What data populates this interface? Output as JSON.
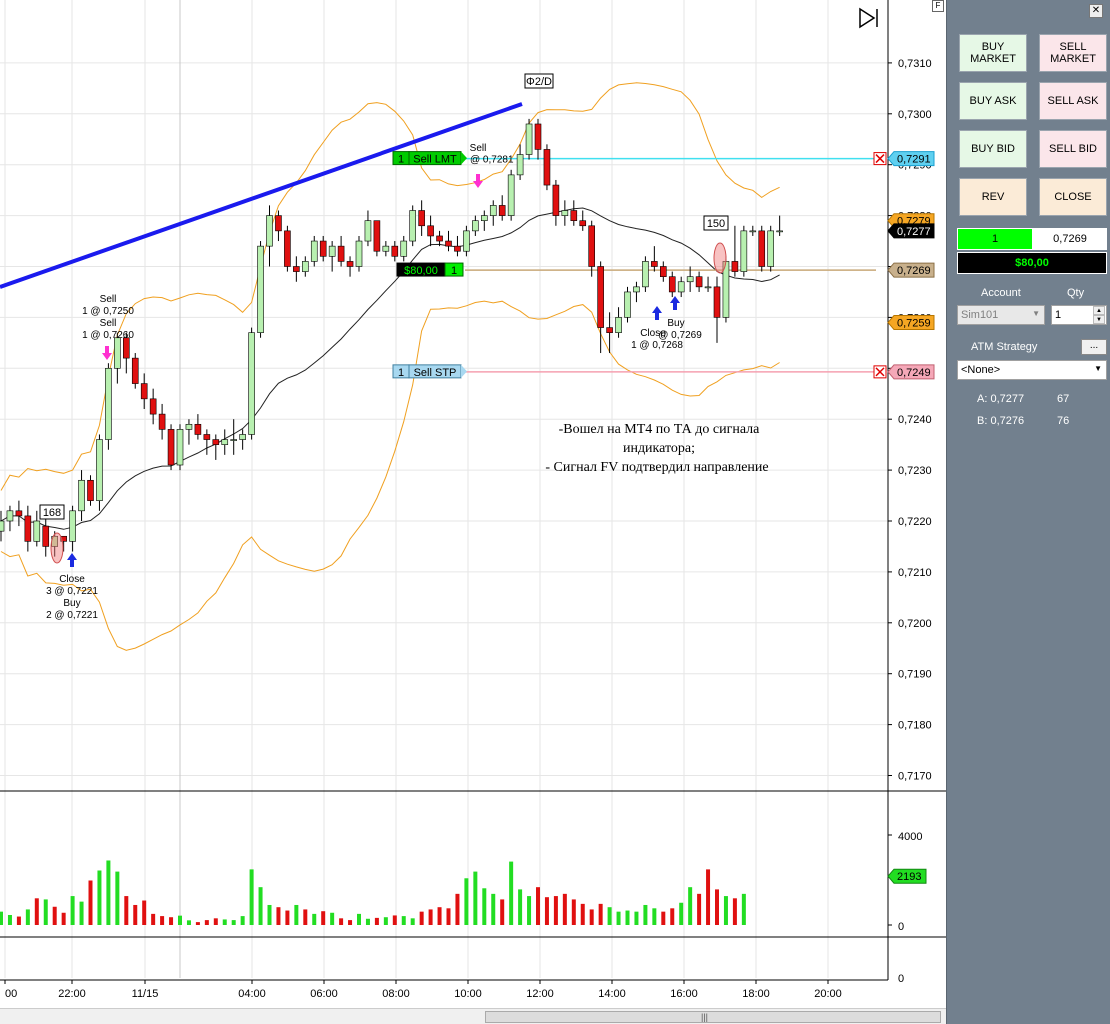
{
  "window": {
    "corner_label": "F",
    "playback_icon": "play-to-end-icon"
  },
  "price_axis": {
    "ticks": [
      "0,7310",
      "0,7300",
      "0,7290",
      "0,7280",
      "0,7270",
      "0,7260",
      "0,7250",
      "0,7240",
      "0,7230",
      "0,7220",
      "0,7210",
      "0,7200",
      "0,7190",
      "0,7180",
      "0,7170"
    ],
    "flags": [
      {
        "text": "0,7291",
        "bg": "#5fd0f0",
        "border": "#1aa0d0"
      },
      {
        "text": "0,7279",
        "bg": "#f5a623",
        "border": "#b87700"
      },
      {
        "text": "0,7277",
        "bg": "#000000",
        "border": "#000000"
      },
      {
        "text": "0,7269",
        "bg": "#c8b08c",
        "border": "#8b6f45"
      },
      {
        "text": "0,7259",
        "bg": "#f5a623",
        "border": "#b87700"
      },
      {
        "text": "0,7249",
        "bg": "#f5a8b8",
        "border": "#c06070"
      }
    ]
  },
  "volume_axis": {
    "ticks": [
      "4000",
      "2000",
      "0",
      "0"
    ],
    "current": "2193"
  },
  "time_axis": {
    "ticks": [
      "00",
      "22:00",
      "11/15",
      "04:00",
      "06:00",
      "08:00",
      "10:00",
      "12:00",
      "14:00",
      "16:00",
      "18:00",
      "20:00"
    ]
  },
  "orders": {
    "sell_lmt": {
      "qty": "1",
      "label": "Sell LMT",
      "price_label": "@ 0,7281"
    },
    "position": {
      "pnl": "$80,00",
      "qty": "1"
    },
    "sell_stp": {
      "qty": "1",
      "label": "Sell STP"
    }
  },
  "annotations": {
    "phi_label": "Φ2/D",
    "box_168": "168",
    "box_150": "150",
    "sell1": "Sell",
    "sell1_qty": "1 @ 0,7250",
    "sell2": "Sell",
    "sell2_qty": "1 @ 0,7260",
    "close1": "Close",
    "close1_qty": "3 @ 0,7221",
    "buy1": "Buy",
    "buy1_qty": "2 @ 0,7221",
    "sell3": "Sell",
    "buy2": "Buy",
    "close2": "Close",
    "buy2_qty": "@ 0,7269",
    "close2_qty": "1 @ 0,7268",
    "note_line1": "-Вошел на МТ4 по ТА до сигнала",
    "note_line2": "индикатора;",
    "note_line3": "- Сигнал FV подтвердил направление"
  },
  "chart_data": {
    "type": "candlestick",
    "title": "",
    "y_range": [
      0.7164,
      0.7322
    ],
    "time_ticks": [
      "00",
      "22:00",
      "11/15",
      "04:00",
      "06:00",
      "08:00",
      "10:00",
      "12:00",
      "14:00",
      "16:00",
      "18:00",
      "20:00"
    ],
    "candles": [
      {
        "o": 0.7218,
        "h": 0.7222,
        "l": 0.7216,
        "c": 0.722
      },
      {
        "o": 0.722,
        "h": 0.7223,
        "l": 0.7218,
        "c": 0.7222
      },
      {
        "o": 0.7222,
        "h": 0.7224,
        "l": 0.7219,
        "c": 0.7221
      },
      {
        "o": 0.7221,
        "h": 0.7223,
        "l": 0.7214,
        "c": 0.7216
      },
      {
        "o": 0.7216,
        "h": 0.7222,
        "l": 0.7215,
        "c": 0.722
      },
      {
        "o": 0.7219,
        "h": 0.7221,
        "l": 0.7213,
        "c": 0.7215
      },
      {
        "o": 0.7215,
        "h": 0.7218,
        "l": 0.7213,
        "c": 0.7217
      },
      {
        "o": 0.7217,
        "h": 0.7216,
        "l": 0.7214,
        "c": 0.7216
      },
      {
        "o": 0.7216,
        "h": 0.7223,
        "l": 0.7214,
        "c": 0.7222
      },
      {
        "o": 0.7222,
        "h": 0.723,
        "l": 0.722,
        "c": 0.7228
      },
      {
        "o": 0.7228,
        "h": 0.7229,
        "l": 0.7223,
        "c": 0.7224
      },
      {
        "o": 0.7224,
        "h": 0.7237,
        "l": 0.7222,
        "c": 0.7236
      },
      {
        "o": 0.7236,
        "h": 0.7251,
        "l": 0.7234,
        "c": 0.725
      },
      {
        "o": 0.725,
        "h": 0.7257,
        "l": 0.7247,
        "c": 0.7256
      },
      {
        "o": 0.7256,
        "h": 0.7257,
        "l": 0.7249,
        "c": 0.7252
      },
      {
        "o": 0.7252,
        "h": 0.7253,
        "l": 0.7246,
        "c": 0.7247
      },
      {
        "o": 0.7247,
        "h": 0.7249,
        "l": 0.7242,
        "c": 0.7244
      },
      {
        "o": 0.7244,
        "h": 0.7246,
        "l": 0.7239,
        "c": 0.7241
      },
      {
        "o": 0.7241,
        "h": 0.7243,
        "l": 0.7236,
        "c": 0.7238
      },
      {
        "o": 0.7238,
        "h": 0.7239,
        "l": 0.723,
        "c": 0.7231
      },
      {
        "o": 0.7231,
        "h": 0.7239,
        "l": 0.723,
        "c": 0.7238
      },
      {
        "o": 0.7238,
        "h": 0.724,
        "l": 0.7235,
        "c": 0.7239
      },
      {
        "o": 0.7239,
        "h": 0.7241,
        "l": 0.7236,
        "c": 0.7237
      },
      {
        "o": 0.7237,
        "h": 0.7238,
        "l": 0.7233,
        "c": 0.7236
      },
      {
        "o": 0.7236,
        "h": 0.7237,
        "l": 0.7232,
        "c": 0.7235
      },
      {
        "o": 0.7235,
        "h": 0.7238,
        "l": 0.7233,
        "c": 0.7236
      },
      {
        "o": 0.7236,
        "h": 0.724,
        "l": 0.7233,
        "c": 0.7236
      },
      {
        "o": 0.7236,
        "h": 0.7238,
        "l": 0.7234,
        "c": 0.7237
      },
      {
        "o": 0.7237,
        "h": 0.7258,
        "l": 0.7236,
        "c": 0.7257
      },
      {
        "o": 0.7257,
        "h": 0.7275,
        "l": 0.7256,
        "c": 0.7274
      },
      {
        "o": 0.7274,
        "h": 0.7282,
        "l": 0.727,
        "c": 0.728
      },
      {
        "o": 0.728,
        "h": 0.7281,
        "l": 0.7275,
        "c": 0.7277
      },
      {
        "o": 0.7277,
        "h": 0.7278,
        "l": 0.7269,
        "c": 0.727
      },
      {
        "o": 0.727,
        "h": 0.7272,
        "l": 0.7267,
        "c": 0.7269
      },
      {
        "o": 0.7269,
        "h": 0.7272,
        "l": 0.7268,
        "c": 0.7271
      },
      {
        "o": 0.7271,
        "h": 0.7276,
        "l": 0.727,
        "c": 0.7275
      },
      {
        "o": 0.7275,
        "h": 0.7276,
        "l": 0.7271,
        "c": 0.7272
      },
      {
        "o": 0.7272,
        "h": 0.7275,
        "l": 0.7269,
        "c": 0.7274
      },
      {
        "o": 0.7274,
        "h": 0.7276,
        "l": 0.727,
        "c": 0.7271
      },
      {
        "o": 0.7271,
        "h": 0.7272,
        "l": 0.7268,
        "c": 0.727
      },
      {
        "o": 0.727,
        "h": 0.7276,
        "l": 0.7269,
        "c": 0.7275
      },
      {
        "o": 0.7275,
        "h": 0.7281,
        "l": 0.7274,
        "c": 0.7279
      },
      {
        "o": 0.7279,
        "h": 0.7279,
        "l": 0.7272,
        "c": 0.7273
      },
      {
        "o": 0.7273,
        "h": 0.7275,
        "l": 0.7272,
        "c": 0.7274
      },
      {
        "o": 0.7274,
        "h": 0.7275,
        "l": 0.7271,
        "c": 0.7272
      },
      {
        "o": 0.7272,
        "h": 0.7276,
        "l": 0.7271,
        "c": 0.7275
      },
      {
        "o": 0.7275,
        "h": 0.7282,
        "l": 0.7274,
        "c": 0.7281
      },
      {
        "o": 0.7281,
        "h": 0.7283,
        "l": 0.7276,
        "c": 0.7278
      },
      {
        "o": 0.7278,
        "h": 0.728,
        "l": 0.7274,
        "c": 0.7276
      },
      {
        "o": 0.7276,
        "h": 0.7277,
        "l": 0.7274,
        "c": 0.7275
      },
      {
        "o": 0.7275,
        "h": 0.7277,
        "l": 0.7273,
        "c": 0.7274
      },
      {
        "o": 0.7274,
        "h": 0.7276,
        "l": 0.7272,
        "c": 0.7273
      },
      {
        "o": 0.7273,
        "h": 0.7278,
        "l": 0.7272,
        "c": 0.7277
      },
      {
        "o": 0.7277,
        "h": 0.728,
        "l": 0.7276,
        "c": 0.7279
      },
      {
        "o": 0.7279,
        "h": 0.7281,
        "l": 0.7277,
        "c": 0.728
      },
      {
        "o": 0.728,
        "h": 0.7283,
        "l": 0.7278,
        "c": 0.7282
      },
      {
        "o": 0.7282,
        "h": 0.7284,
        "l": 0.7279,
        "c": 0.728
      },
      {
        "o": 0.728,
        "h": 0.7289,
        "l": 0.7279,
        "c": 0.7288
      },
      {
        "o": 0.7288,
        "h": 0.7294,
        "l": 0.7287,
        "c": 0.7292
      },
      {
        "o": 0.7292,
        "h": 0.7299,
        "l": 0.7291,
        "c": 0.7298
      },
      {
        "o": 0.7298,
        "h": 0.7299,
        "l": 0.7291,
        "c": 0.7293
      },
      {
        "o": 0.7293,
        "h": 0.7294,
        "l": 0.7285,
        "c": 0.7286
      },
      {
        "o": 0.7286,
        "h": 0.7287,
        "l": 0.7278,
        "c": 0.728
      },
      {
        "o": 0.728,
        "h": 0.7283,
        "l": 0.7278,
        "c": 0.7281
      },
      {
        "o": 0.7281,
        "h": 0.7283,
        "l": 0.7278,
        "c": 0.7279
      },
      {
        "o": 0.7279,
        "h": 0.7281,
        "l": 0.7277,
        "c": 0.7278
      },
      {
        "o": 0.7278,
        "h": 0.7279,
        "l": 0.7268,
        "c": 0.727
      },
      {
        "o": 0.727,
        "h": 0.7271,
        "l": 0.7253,
        "c": 0.7258
      },
      {
        "o": 0.7258,
        "h": 0.7261,
        "l": 0.7253,
        "c": 0.7257
      },
      {
        "o": 0.7257,
        "h": 0.7262,
        "l": 0.7256,
        "c": 0.726
      },
      {
        "o": 0.726,
        "h": 0.7266,
        "l": 0.7259,
        "c": 0.7265
      },
      {
        "o": 0.7265,
        "h": 0.7267,
        "l": 0.7263,
        "c": 0.7266
      },
      {
        "o": 0.7266,
        "h": 0.7272,
        "l": 0.7265,
        "c": 0.7271
      },
      {
        "o": 0.7271,
        "h": 0.7274,
        "l": 0.7269,
        "c": 0.727
      },
      {
        "o": 0.727,
        "h": 0.7271,
        "l": 0.7267,
        "c": 0.7268
      },
      {
        "o": 0.7268,
        "h": 0.7269,
        "l": 0.7264,
        "c": 0.7265
      },
      {
        "o": 0.7265,
        "h": 0.7268,
        "l": 0.7264,
        "c": 0.7267
      },
      {
        "o": 0.7267,
        "h": 0.727,
        "l": 0.7265,
        "c": 0.7268
      },
      {
        "o": 0.7268,
        "h": 0.7269,
        "l": 0.7265,
        "c": 0.7266
      },
      {
        "o": 0.7266,
        "h": 0.7268,
        "l": 0.7265,
        "c": 0.7266
      },
      {
        "o": 0.7266,
        "h": 0.7268,
        "l": 0.7255,
        "c": 0.726
      },
      {
        "o": 0.726,
        "h": 0.7272,
        "l": 0.7259,
        "c": 0.7271
      },
      {
        "o": 0.7271,
        "h": 0.7278,
        "l": 0.7268,
        "c": 0.7269
      },
      {
        "o": 0.7269,
        "h": 0.7278,
        "l": 0.7268,
        "c": 0.7277
      },
      {
        "o": 0.7277,
        "h": 0.7278,
        "l": 0.7276,
        "c": 0.7277
      },
      {
        "o": 0.7277,
        "h": 0.7278,
        "l": 0.7269,
        "c": 0.727
      },
      {
        "o": 0.727,
        "h": 0.7278,
        "l": 0.7269,
        "c": 0.7277
      },
      {
        "o": 0.7277,
        "h": 0.728,
        "l": 0.7276,
        "c": 0.7277
      }
    ],
    "volume": [
      600,
      450,
      380,
      700,
      1200,
      1150,
      820,
      550,
      1300,
      1050,
      2000,
      2450,
      2900,
      2400,
      1300,
      900,
      1100,
      500,
      400,
      350,
      420,
      210,
      130,
      220,
      300,
      250,
      220,
      400,
      2500,
      1700,
      900,
      800,
      650,
      900,
      700,
      500,
      620,
      550,
      300,
      220,
      500,
      280,
      320,
      350,
      430,
      400,
      300,
      600,
      700,
      800,
      750,
      1400,
      2100,
      2400,
      1650,
      1400,
      1150,
      2850,
      1600,
      1300,
      1700,
      1250,
      1300,
      1400,
      1150,
      950,
      700,
      950,
      800,
      600,
      650,
      600,
      900,
      750,
      600,
      750,
      1000,
      1700,
      1400,
      2500,
      1600,
      1300,
      1200,
      1400
    ],
    "volume_up": [
      true,
      true,
      false,
      true,
      false,
      true,
      false,
      false,
      true,
      true,
      false,
      true,
      true,
      true,
      false,
      false,
      false,
      false,
      false,
      false,
      true,
      true,
      false,
      false,
      false,
      true,
      true,
      true,
      true,
      true,
      true,
      false,
      false,
      true,
      false,
      true,
      false,
      true,
      false,
      false,
      true,
      true,
      false,
      true,
      false,
      true,
      true,
      false,
      false,
      false,
      false,
      false,
      true,
      true,
      true,
      true,
      false,
      true,
      true,
      true,
      false,
      false,
      false,
      false,
      false,
      false,
      false,
      false,
      true,
      true,
      true,
      true,
      true,
      true,
      false,
      false,
      true,
      true,
      false,
      false,
      false,
      true,
      false,
      true,
      true
    ]
  },
  "panel": {
    "close_icon": "close-icon",
    "buttons": {
      "buy_market": "BUY\nMARKET",
      "sell_market": "SELL\nMARKET",
      "buy_ask": "BUY ASK",
      "sell_ask": "SELL ASK",
      "buy_bid": "BUY BID",
      "sell_bid": "SELL BID",
      "rev": "REV",
      "close": "CLOSE"
    },
    "position_qty": "1",
    "position_price": "0,7269",
    "pnl": "$80,00",
    "account_label": "Account",
    "qty_label": "Qty",
    "account_value": "Sim101",
    "qty_value": "1",
    "atm_label": "ATM Strategy",
    "atm_button": "...",
    "atm_value": "<None>",
    "ask_label": "A: 0,7277",
    "ask_size": "67",
    "bid_label": "B: 0,7276",
    "bid_size": "76",
    "colors": {
      "long": "#00ff00",
      "pnl_bg": "#000000",
      "pnl_text": "#00ff00"
    }
  }
}
